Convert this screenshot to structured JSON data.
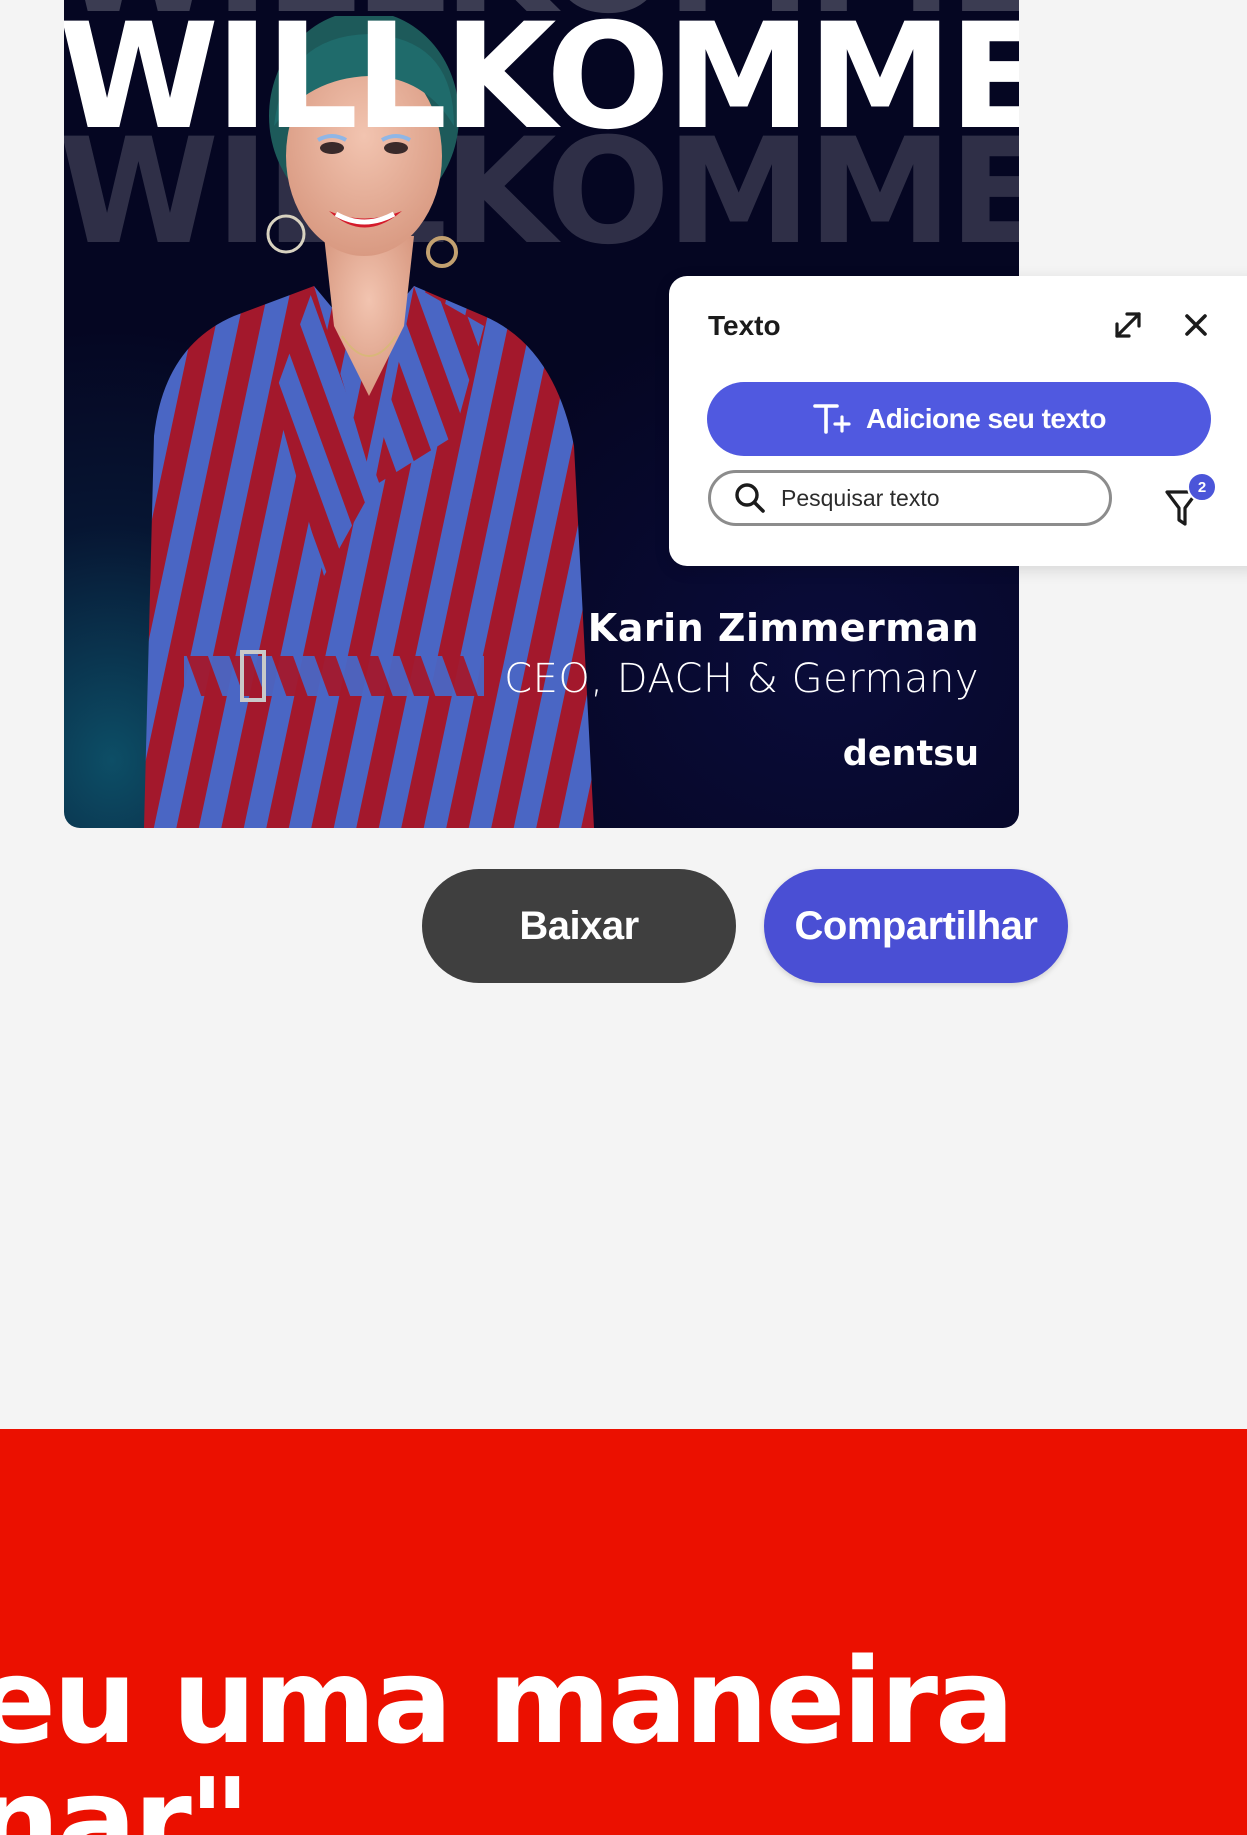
{
  "hero": {
    "headline": "WILLKOMMEN",
    "person_name": "Karin Zimmerman",
    "person_role": "CEO, DACH & Germany",
    "brand": "dentsu"
  },
  "text_panel": {
    "title": "Texto",
    "expand_icon": "expand-icon",
    "close_icon": "close-icon",
    "add_text_label": "Adicione seu texto",
    "search_placeholder": "Pesquisar texto",
    "filter_count": "2",
    "accent_color": "#5059e0"
  },
  "actions": {
    "download_label": "Baixar",
    "share_label": "Compartilhar"
  },
  "banner": {
    "quote_line1": "eu uma maneira",
    "quote_line2": "nar\"",
    "color": "#eb1000"
  }
}
